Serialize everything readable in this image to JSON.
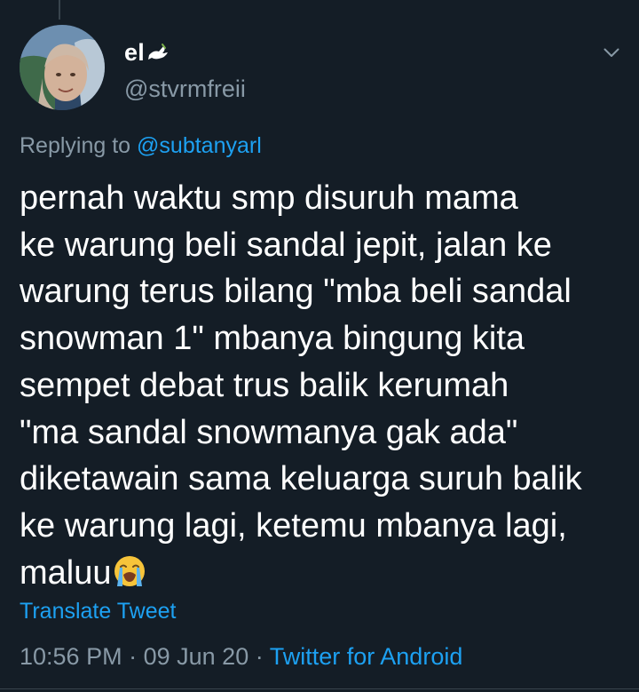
{
  "tweet": {
    "display_name": "el",
    "handle": "@stvrmfreii",
    "replying_prefix": "Replying to",
    "replying_mention": "@subtanyarl",
    "text_lines": [
      "pernah waktu smp disuruh mama",
      "ke warung beli sandal jepit, jalan ke",
      "warung terus bilang \"mba beli sandal",
      "snowman 1\" mbanya bingung kita",
      "sempet debat trus balik kerumah",
      "\"ma sandal snowmanya gak ada\"",
      "diketawain sama keluarga suruh balik",
      "ke warung lagi, ketemu mbanya lagi,",
      "maluu"
    ],
    "translate_label": "Translate Tweet",
    "time": "10:56 PM",
    "separator": "·",
    "date": "09 Jun 20",
    "source": "Twitter for Android"
  },
  "icons": {
    "name_badge": "dove-icon",
    "menu": "chevron-down-icon",
    "text_emoji": "loudly-crying-face-emoji"
  },
  "colors": {
    "background": "#141d26",
    "primary_text": "#ffffff",
    "secondary_text": "#8899a6",
    "accent": "#1da1f2"
  }
}
